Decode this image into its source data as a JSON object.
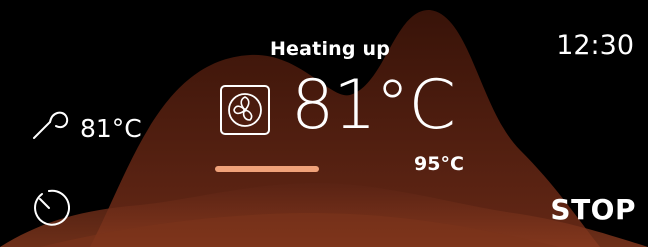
{
  "header": {
    "status_text": "Heating up",
    "clock": "12:30"
  },
  "probe": {
    "icon": "meat-probe-icon",
    "temperature": "81°C"
  },
  "main": {
    "mode_icon": "fan-icon",
    "current_temperature": "81°C"
  },
  "progress": {
    "value": 0.81,
    "target_temperature": "95°C"
  },
  "controls": {
    "timer_icon": "timer-icon",
    "stop_label": "STOP"
  },
  "colors": {
    "background": "#000000",
    "accent": "#f0a27a",
    "track": "#8a8a8a",
    "flame_dark": "#3a160e",
    "flame_mid": "#5a2415"
  }
}
